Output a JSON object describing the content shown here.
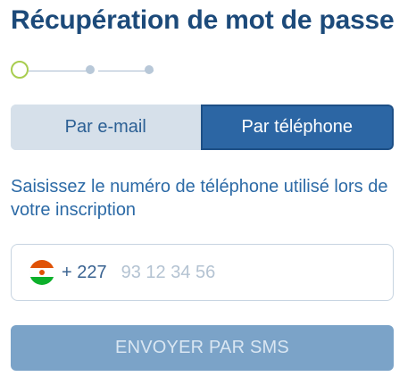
{
  "page": {
    "title": "Récupération de mot de passe"
  },
  "stepper": {
    "total_steps": 3,
    "current_step": 1,
    "colors": {
      "active": "#a8cd4f",
      "inactive": "#b8c8d8"
    }
  },
  "tabs": [
    {
      "label": "Par e-mail",
      "selected": false
    },
    {
      "label": "Par téléphone",
      "selected": true
    }
  ],
  "instruction": "Saisissez le numéro de téléphone utilisé lors de votre inscription",
  "phone": {
    "flag_icon": "niger-flag-icon",
    "country_code": "+ 227",
    "value": "",
    "placeholder": "93 12 34 56"
  },
  "submit": {
    "label": "ENVOYER PAR SMS",
    "enabled": false
  },
  "colors": {
    "title": "#1c4a7a",
    "accent": "#2c66a4",
    "disabled_button": "#7ba3c8"
  }
}
